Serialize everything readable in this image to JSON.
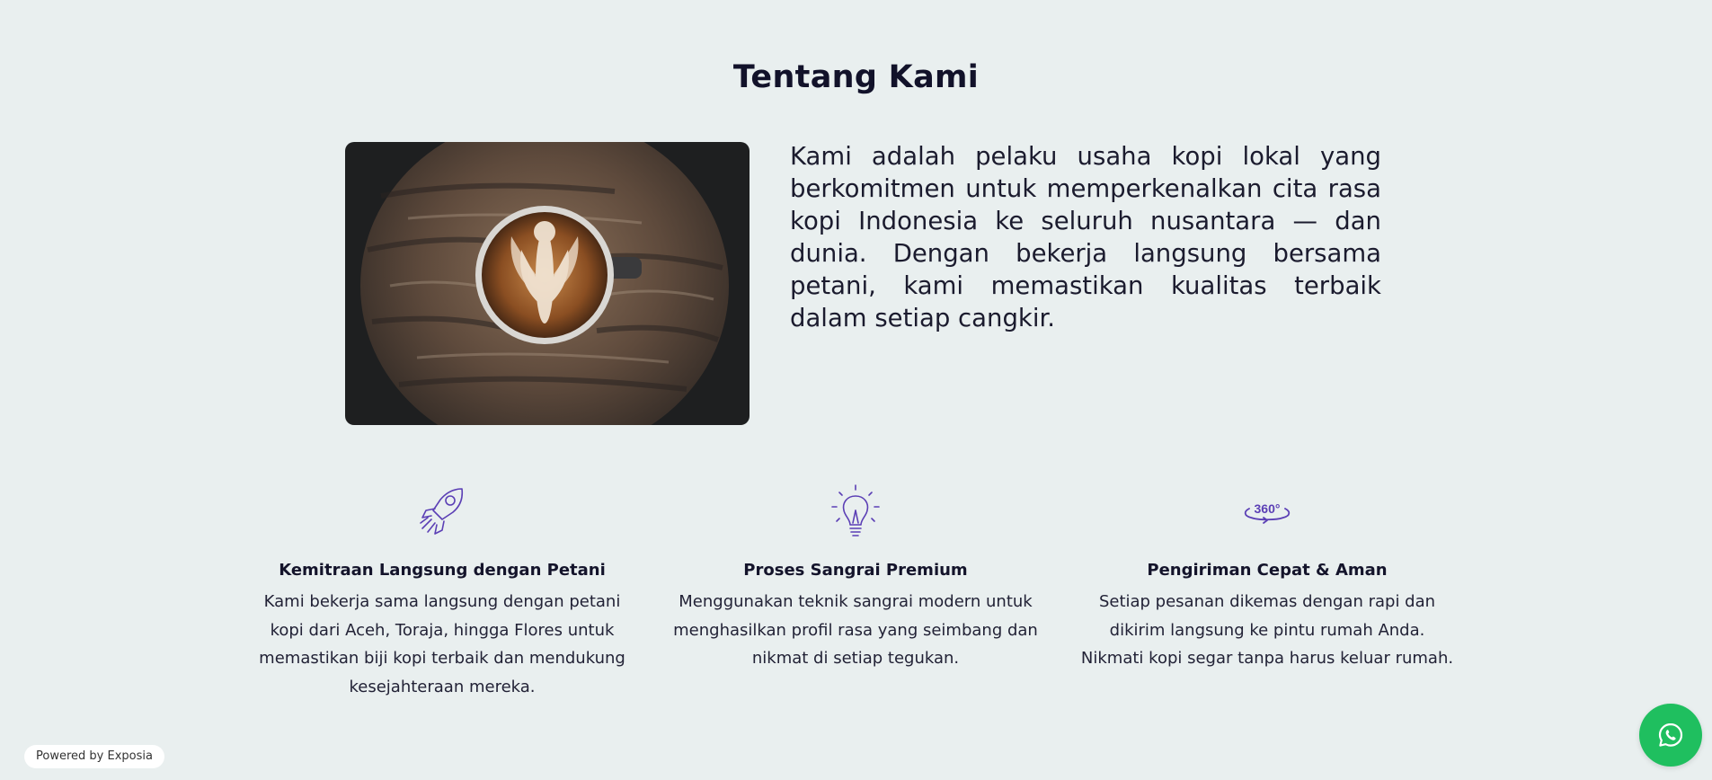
{
  "section": {
    "title": "Tentang Kami",
    "description": "Kami adalah pelaku usaha kopi lokal yang berkomitmen untuk memperkenalkan cita rasa kopi Indonesia ke seluruh nusantara — dan dunia. Dengan bekerja langsung bersama petani, kami memastikan kualitas terbaik dalam setiap cangkir."
  },
  "features": [
    {
      "icon": "rocket-icon",
      "title": "Kemitraan Langsung dengan Petani",
      "text": "Kami bekerja sama langsung dengan petani kopi dari Aceh, Toraja, hingga Flores untuk memastikan biji kopi terbaik dan mendukung kesejahteraan mereka."
    },
    {
      "icon": "lightbulb-icon",
      "title": "Proses Sangrai Premium",
      "text": "Menggunakan teknik sangrai modern untuk menghasilkan profil rasa yang seimbang dan nikmat di setiap tegukan."
    },
    {
      "icon": "rotate-360-icon",
      "icon_label": "360°",
      "title": "Pengiriman Cepat & Aman",
      "text": "Setiap pesanan dikemas dengan rapi dan dikirim langsung ke pintu rumah Anda. Nikmati kopi segar tanpa harus keluar rumah."
    }
  ],
  "footer": {
    "powered_by": "Powered by Exposia"
  },
  "whatsapp": {
    "icon": "whatsapp-icon"
  },
  "colors": {
    "background": "#e9efef",
    "accent": "#5b3fb5",
    "whatsapp": "#1fbf5f",
    "text": "#14142b"
  }
}
